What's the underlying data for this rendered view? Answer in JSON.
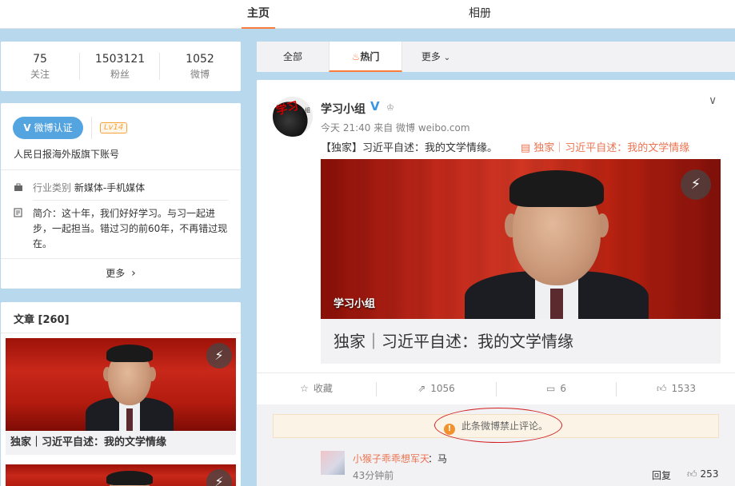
{
  "top_tabs": {
    "home": "主页",
    "album": "相册"
  },
  "stats": [
    {
      "value": "75",
      "label": "关注"
    },
    {
      "value": "1503121",
      "label": "粉丝"
    },
    {
      "value": "1052",
      "label": "微博"
    }
  ],
  "profile": {
    "verify_icon": "V",
    "verify_label": "微博认证",
    "level": "Lv14",
    "description": "人民日报海外版旗下账号",
    "industry_key": "行业类别",
    "industry_value": "新媒体-手机媒体",
    "intro": "简介：这十年，我们好好学习。与习一起进步，一起担当。错过习的前60年，不再错过现在。",
    "more": "更多",
    "more_arrow": "›"
  },
  "articles": {
    "header": "文章 [260]",
    "items": [
      {
        "caption": "独家｜习近平自述：我的文学情缘"
      }
    ]
  },
  "feed_tabs": {
    "all": "全部",
    "hot": "热门",
    "more": "更多",
    "hot_icon": "flame-icon"
  },
  "post": {
    "avatar_text": "学习",
    "avatar_small": "小组",
    "username": "学习小组",
    "verified_mark": "V",
    "crown": "♔",
    "meta": "今天 21:40 来自 微博 weibo.com",
    "chevron": "∨",
    "text": "【独家】习近平自述：我的文学情缘。",
    "link_text": "独家｜习近平自述：我的文学情缘",
    "image_label": "学习小组",
    "caption": "独家｜习近平自述：我的文学情缘",
    "flash_icon": "⚡",
    "actions": {
      "collect": "收藏",
      "forward": "1056",
      "comment": "6",
      "like": "1533"
    },
    "notice": "此条微博禁止评论。",
    "notice_icon": "!",
    "comment": {
      "user": "小猴子乖乖想军天",
      "text": "：马",
      "time": "43分钟前",
      "reply": "回复",
      "likes": "253"
    }
  },
  "colors": {
    "accent_orange": "#fa7d3c",
    "link_orange": "#eb7350",
    "verify_blue": "#54a4e0",
    "page_bg": "#b8d8ee"
  }
}
